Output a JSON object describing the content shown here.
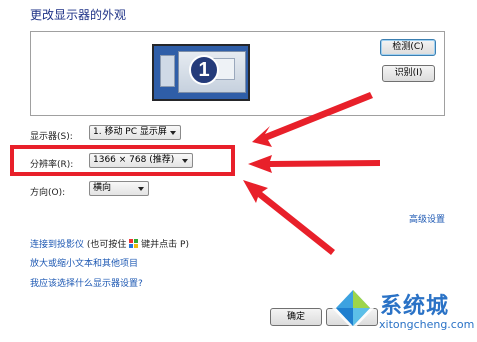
{
  "header": {
    "title": "更改显示器的外观"
  },
  "preview": {
    "monitor_number": "1",
    "detect_label": "检测(C)",
    "identify_label": "识别(I)"
  },
  "settings": {
    "display_label": "显示器(S):",
    "display_value": "1. 移动 PC 显示屏",
    "resolution_label": "分辨率(R):",
    "resolution_value": "1366 × 768 (推荐)",
    "orientation_label": "方向(O):",
    "orientation_value": "横向"
  },
  "links": {
    "advanced": "高级设置",
    "projector": "连接到投影仪",
    "projector_hint_prefix": "(也可按住",
    "projector_hint_suffix": "键并点击 P)",
    "text_size": "放大或缩小文本和其他项目",
    "help": "我应该选择什么显示器设置?"
  },
  "footer": {
    "ok_label": "确定",
    "cancel_label": "取"
  },
  "watermark": {
    "brand": "系统城",
    "domain": "xitongcheng.com"
  },
  "colors": {
    "annotation": "#e8202a",
    "link": "#1d58b3",
    "title": "#1e3287"
  }
}
